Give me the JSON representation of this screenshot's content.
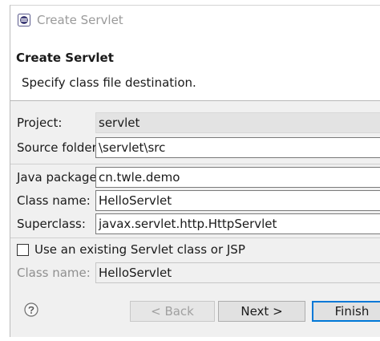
{
  "window": {
    "title": "Create Servlet",
    "title_icon": "eclipse-wizard-icon"
  },
  "banner": {
    "title": "Create Servlet",
    "message": "Specify class file destination."
  },
  "form": {
    "project": {
      "label": "Project:",
      "value": "servlet"
    },
    "source_folder": {
      "label": "Source folder:",
      "value": "\\servlet\\src"
    },
    "java_package": {
      "label": "Java package:",
      "value": "cn.twle.demo"
    },
    "class_name": {
      "label": "Class name:",
      "value": "HelloServlet"
    },
    "superclass": {
      "label": "Superclass:",
      "value": "javax.servlet.http.HttpServlet"
    },
    "use_existing": {
      "label": "Use an existing Servlet class or JSP",
      "checked": false
    },
    "existing_class_name": {
      "label": "Class name:",
      "value": "HelloServlet"
    }
  },
  "footer": {
    "help_icon": "help-question-icon",
    "back_label": "< Back",
    "next_label": "Next >",
    "finish_label": "Finish"
  },
  "colors": {
    "primary_focus": "#0078d7",
    "dialog_background": "#f0f0f0"
  }
}
